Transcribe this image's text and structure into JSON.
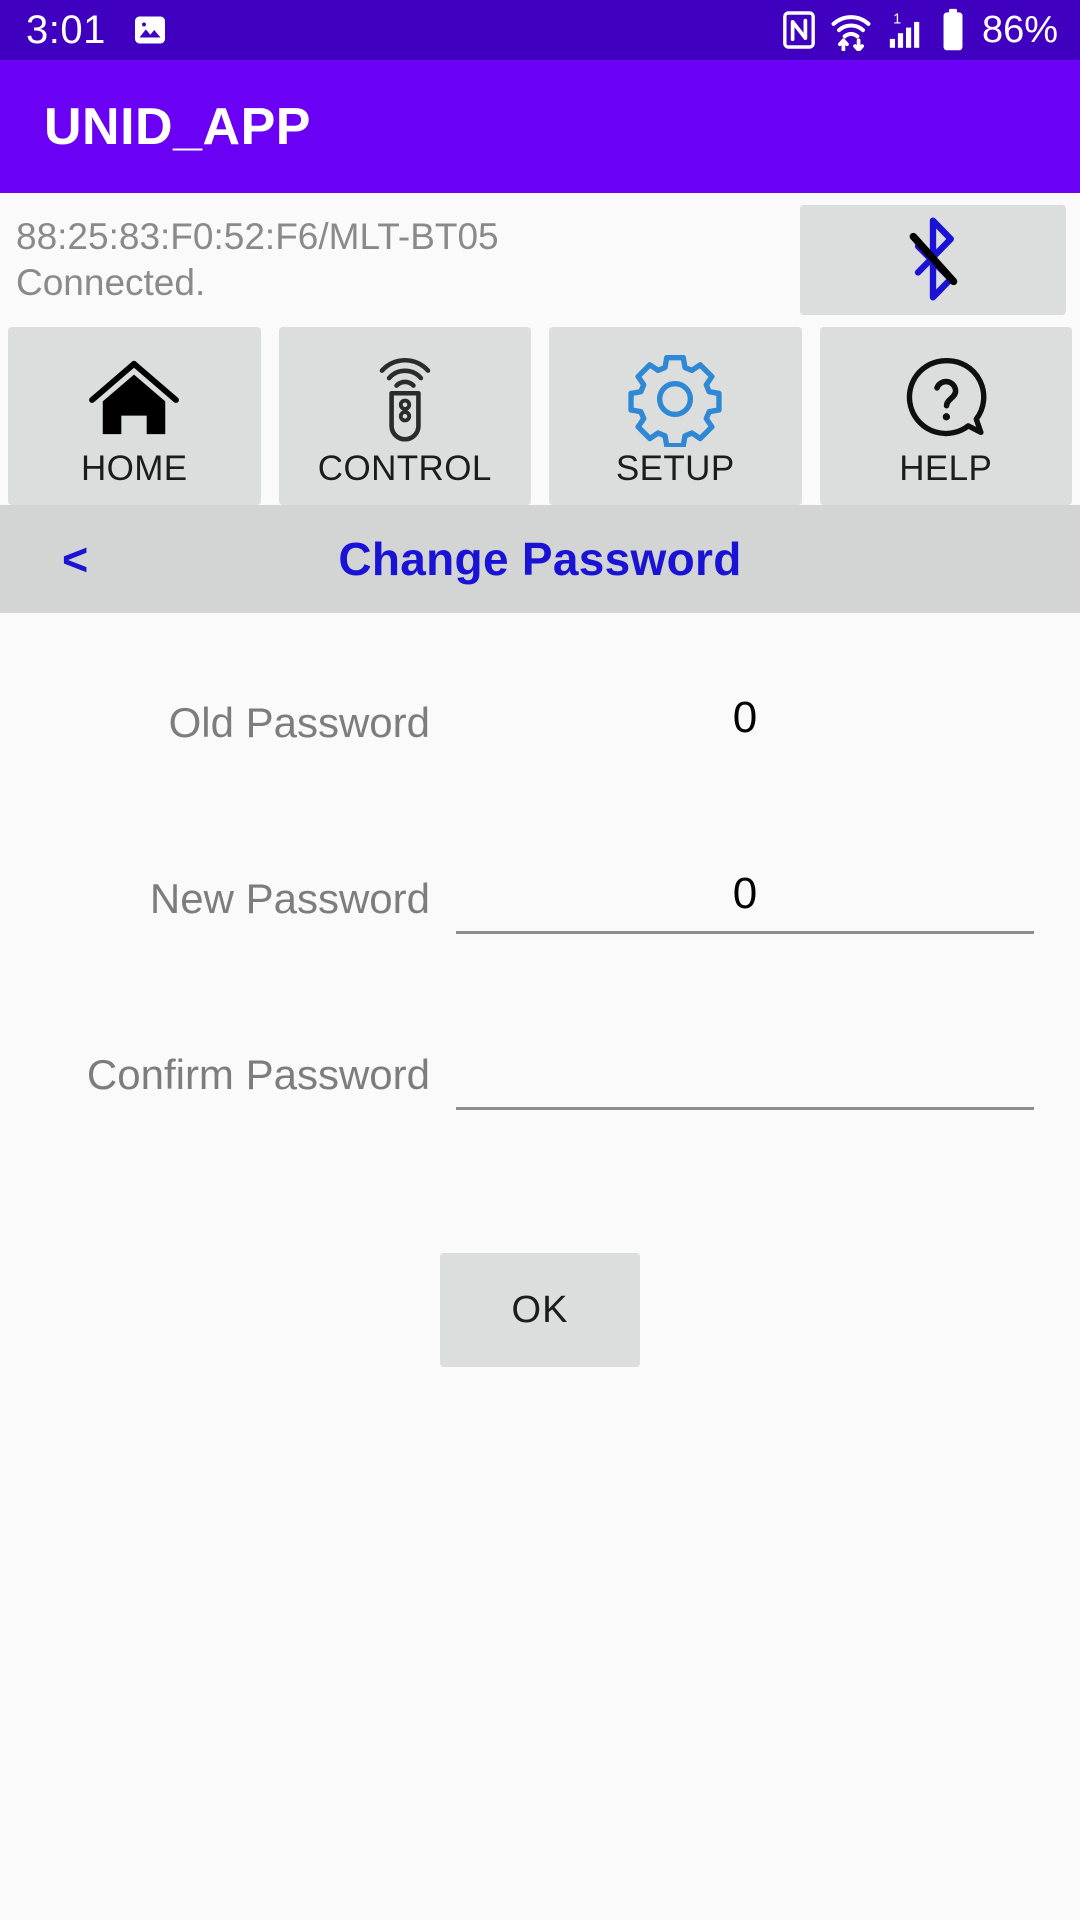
{
  "status_bar": {
    "time": "3:01",
    "battery_percent": "86%",
    "icons": [
      "gallery-image-icon",
      "nfc-icon",
      "wifi-icon",
      "cellular-signal-icon",
      "battery-icon"
    ],
    "background_color": "#3f00bf"
  },
  "app_bar": {
    "title": "UNID_APP",
    "background_color": "#6a00f4"
  },
  "device": {
    "address": "88:25:83:F0:52:F6/MLT-BT05",
    "status": "Connected.",
    "disconnect_icon": "bluetooth-disabled-icon",
    "accent_color": "#1a13d6"
  },
  "nav": {
    "items": [
      {
        "label": "HOME",
        "icon": "home-icon",
        "active": false
      },
      {
        "label": "CONTROL",
        "icon": "remote-control-icon",
        "active": false
      },
      {
        "label": "SETUP",
        "icon": "gear-icon",
        "active": true
      },
      {
        "label": "HELP",
        "icon": "help-question-icon",
        "active": false
      }
    ]
  },
  "section": {
    "back_label": "<",
    "title": "Change Password",
    "title_color": "#1a13d6",
    "background_color": "#d3d5d4"
  },
  "form": {
    "fields": [
      {
        "label": "Old Password",
        "value": "0",
        "placeholder": "",
        "underlined": false
      },
      {
        "label": "New Password",
        "value": "0",
        "placeholder": "",
        "underlined": true
      },
      {
        "label": "Confirm Password",
        "value": "",
        "placeholder": "",
        "underlined": true
      }
    ],
    "submit_label": "OK"
  }
}
